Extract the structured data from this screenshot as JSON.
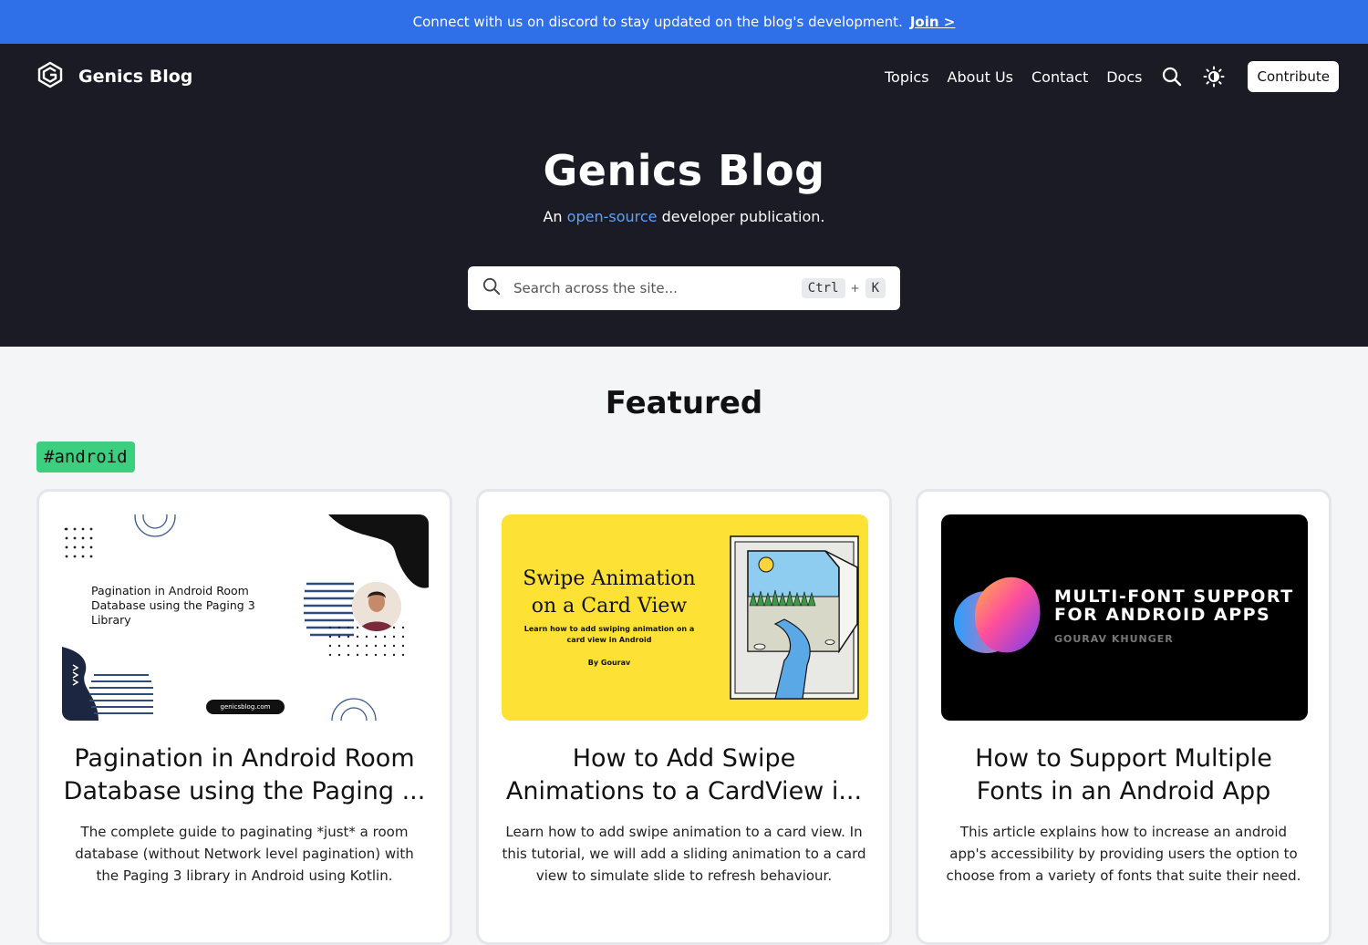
{
  "announcement": {
    "text": "Connect with us on discord to stay updated on the blog's development.",
    "link": "Join >"
  },
  "nav": {
    "brand": "Genics Blog",
    "links": [
      "Topics",
      "About Us",
      "Contact",
      "Docs"
    ],
    "search_icon": "search-icon",
    "theme_icon": "sun-icon",
    "contribute": "Contribute"
  },
  "hero": {
    "title": "Genics Blog",
    "subtitle_pre": "An",
    "subtitle_accent": "open-source",
    "subtitle_post": "developer publication."
  },
  "search": {
    "placeholder": "Search across the site...",
    "key1": "Ctrl",
    "plus": "+",
    "key2": "K"
  },
  "featured": {
    "title": "Featured",
    "tag": "#android"
  },
  "cards": [
    {
      "title": "Pagination in Android Room Database using the Paging ...",
      "description": "The complete guide to paginating *just* a room database (without Network level pagination) with the Paging 3 library in Android using Kotlin.",
      "thumb_text": "Pagination in Android Room Database using the Paging 3 Library",
      "thumb_url": "genicsblog.com"
    },
    {
      "title": "How to Add Swipe Animations to a CardView i...",
      "description": "Learn how to add swipe animation to a card view. In this tutorial, we will add a sliding animation to a card view to simulate slide to refresh behaviour.",
      "thumb_heading": "Swipe Animation on a Card View",
      "thumb_sub": "Learn how to add swiping animation on a card view in Android",
      "thumb_by": "By Gourav"
    },
    {
      "title": "How to Support Multiple Fonts in an Android App",
      "description": "This article explains how to increase an android app's accessibility by providing users the option to choose from a variety of fonts that suite their need.",
      "thumb_heading": "MULTI-FONT SUPPORT FOR ANDROID APPS",
      "thumb_author": "GOURAV KHUNGER"
    }
  ],
  "colors": {
    "announce": "#2f6fe8",
    "hero_bg": "#1a1b25",
    "accent": "#5aa2ff",
    "tag": "#3ccf7f"
  }
}
